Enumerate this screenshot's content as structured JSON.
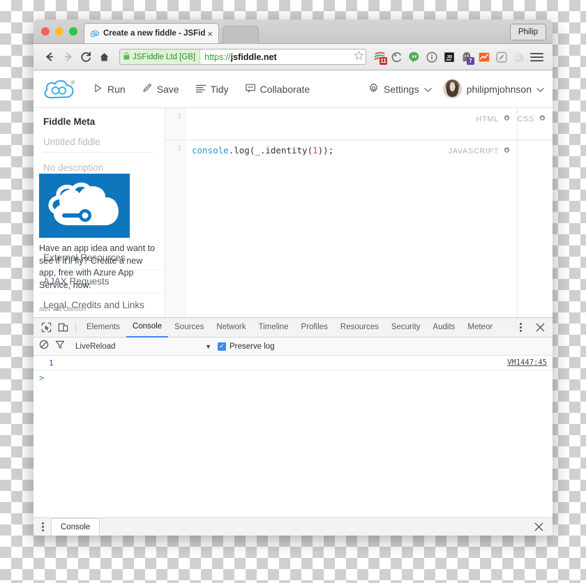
{
  "browser": {
    "tab": {
      "title": "Create a new fiddle - JSFid",
      "favicon_name": "jsfiddle-favicon",
      "close_label": "×"
    },
    "profile_button": "Philip",
    "nav": {
      "back_label": "←",
      "forward_label": "→",
      "reload_label": "C",
      "home_label": "⌂"
    },
    "omnibox": {
      "ev_certificate": "JSFiddle Ltd [GB]",
      "scheme": "https://",
      "host": "jsfiddle.net",
      "lock_icon": "green-lock-icon",
      "bookmark_icon": "star-icon"
    },
    "extensions": [
      {
        "name": "adblock-extension-icon",
        "badge": "11",
        "badge_color": "#c0392b"
      },
      {
        "name": "refresh-extension-icon",
        "badge": "",
        "badge_color": ""
      },
      {
        "name": "hangouts-extension-icon",
        "badge": "",
        "badge_color": ""
      },
      {
        "name": "info-extension-icon",
        "badge": "",
        "badge_color": ""
      },
      {
        "name": "jetbrains-extension-icon",
        "badge": "",
        "badge_color": ""
      },
      {
        "name": "ghost-extension-icon",
        "badge": "7",
        "badge_color": "#6b3fa0"
      },
      {
        "name": "analytics-extension-icon",
        "badge": "",
        "badge_color": ""
      },
      {
        "name": "comet-extension-icon",
        "badge": "",
        "badge_color": ""
      },
      {
        "name": "drive-extension-icon",
        "badge": "",
        "badge_color": ""
      }
    ],
    "menu_icon": "hamburger-menu-icon"
  },
  "jsfiddle": {
    "logo_name": "jsfiddle-cloud-logo",
    "actions": [
      {
        "label": "Run",
        "icon": "play-icon"
      },
      {
        "label": "Save",
        "icon": "pencil-icon"
      },
      {
        "label": "Tidy",
        "icon": "lines-icon"
      },
      {
        "label": "Collaborate",
        "icon": "chat-icon"
      }
    ],
    "settings": {
      "label": "Settings",
      "icon": "gear-icon",
      "caret": "⌄"
    },
    "account": {
      "username": "philipmjohnson",
      "avatar_name": "user-avatar",
      "caret": "⌄"
    }
  },
  "sidebar": {
    "heading": "Fiddle Meta",
    "title_placeholder": "Untitled fiddle",
    "description_placeholder": "No description",
    "links": [
      "External Resources",
      "AJAX Requests",
      "Legal, Credits and Links"
    ]
  },
  "ad": {
    "image_name": "azure-cloud-ad-image",
    "copy": "Have an app idea and want to see if it'll fly? Create a new app, free with Azure App Service, now.",
    "via": "ads via Carbon"
  },
  "editors": {
    "html": {
      "label": "HTML",
      "gear": "gear-icon",
      "line_numbers": [
        "1"
      ],
      "content": ""
    },
    "css": {
      "label": "CSS",
      "gear": "gear-icon"
    },
    "js": {
      "label": "JAVASCRIPT",
      "gear": "gear-icon",
      "line_numbers": [
        "1"
      ],
      "tokens": [
        {
          "text": "console",
          "type": "object"
        },
        {
          "text": ".log(_.identity(",
          "type": "plain"
        },
        {
          "text": "1",
          "type": "number"
        },
        {
          "text": "));",
          "type": "plain"
        }
      ]
    }
  },
  "devtools": {
    "inspect_icon": "inspect-element-icon",
    "device_icon": "device-toolbar-icon",
    "tabs": [
      "Elements",
      "Console",
      "Sources",
      "Network",
      "Timeline",
      "Profiles",
      "Resources",
      "Security",
      "Audits",
      "Meteor"
    ],
    "active_tab": "Console",
    "more_icon": "kebab-menu-icon",
    "close_icon": "close-icon",
    "filterbar": {
      "clear_icon": "clear-console-icon",
      "filter_icon": "filter-icon",
      "context": "LiveReload",
      "caret": "▼",
      "preserve_log_label": "Preserve log",
      "preserve_log_checked": true,
      "check_glyph": "✓"
    },
    "console_rows": [
      {
        "value": "1",
        "source": "VM1447:45"
      }
    ],
    "prompt": ">",
    "drawer": {
      "tab": "Console",
      "close_icon": "close-icon",
      "more_icon": "kebab-menu-icon"
    }
  },
  "colors": {
    "accent_blue": "#4285f4",
    "ad_blue": "#0f75bd",
    "ev_green": "#2c8c2c",
    "token_object": "#2b91d4",
    "token_number": "#e8475f",
    "console_value": "#2b43d6"
  }
}
